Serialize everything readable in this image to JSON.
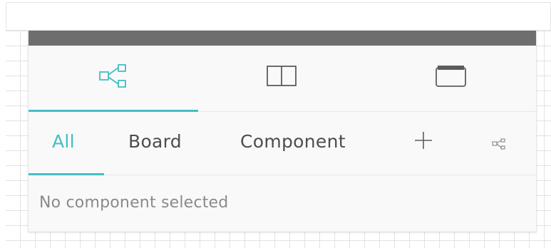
{
  "view_tabs": [
    {
      "icon": "hierarchy-icon",
      "active": true
    },
    {
      "icon": "split-panel-icon",
      "active": false
    },
    {
      "icon": "window-icon",
      "active": false
    }
  ],
  "sub_tabs": {
    "all": "All",
    "board": "Board",
    "component": "Component"
  },
  "status": {
    "empty_message": "No component selected"
  },
  "colors": {
    "accent": "#42bfc4",
    "header": "#6e6e6e",
    "text": "#4d4d4d",
    "muted": "#8a8a8a"
  }
}
